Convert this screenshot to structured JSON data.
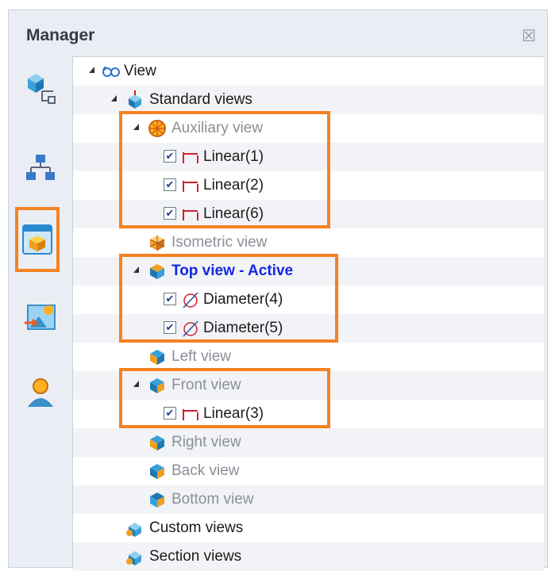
{
  "panel": {
    "title": "Manager",
    "close_glyph": "☒"
  },
  "sidebar": {
    "items": [
      {
        "icon": "part-tree-icon"
      },
      {
        "icon": "hierarchy-icon"
      },
      {
        "icon": "view-manager-icon",
        "active": true
      },
      {
        "icon": "export-image-icon"
      },
      {
        "icon": "user-icon"
      }
    ]
  },
  "tree": {
    "root": "View",
    "standard": "Standard views",
    "auxiliary": "Auxiliary view",
    "linear1": "Linear(1)",
    "linear2": "Linear(2)",
    "linear6": "Linear(6)",
    "isometric": "Isometric view",
    "top": "Top view - Active",
    "diameter4": "Diameter(4)",
    "diameter5": "Diameter(5)",
    "left": "Left view",
    "front": "Front view",
    "linear3": "Linear(3)",
    "right": "Right view",
    "back": "Back view",
    "bottom": "Bottom view",
    "custom": "Custom views",
    "section": "Section views",
    "check_glyph": "✔"
  },
  "colors": {
    "highlight": "#f58220",
    "active_text": "#1428e0"
  }
}
